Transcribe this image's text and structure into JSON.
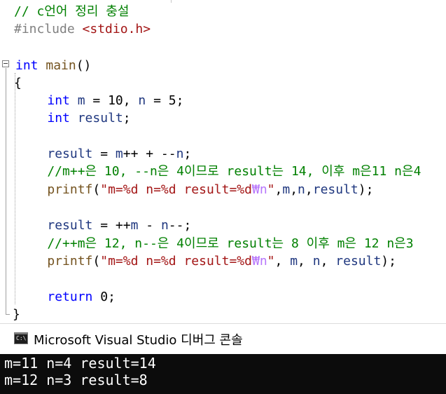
{
  "editor": {
    "lines": [
      [
        {
          "t": "// c언어 정리 충설",
          "c": "comment"
        }
      ],
      [
        {
          "t": "#include ",
          "c": "pp"
        },
        {
          "t": "<stdio.h>",
          "c": "string"
        }
      ],
      [],
      [
        {
          "t": "int",
          "c": "keyword"
        },
        {
          "t": " ",
          "c": "plain"
        },
        {
          "t": "main",
          "c": "func"
        },
        {
          "t": "()",
          "c": "plain"
        }
      ],
      [
        {
          "t": "{",
          "c": "plain"
        }
      ],
      [
        {
          "t": "    ",
          "c": "plain"
        },
        {
          "t": "int",
          "c": "keyword"
        },
        {
          "t": " ",
          "c": "plain"
        },
        {
          "t": "m",
          "c": "var"
        },
        {
          "t": " = 10, ",
          "c": "plain"
        },
        {
          "t": "n",
          "c": "var"
        },
        {
          "t": " = 5;",
          "c": "plain"
        }
      ],
      [
        {
          "t": "    ",
          "c": "plain"
        },
        {
          "t": "int",
          "c": "keyword"
        },
        {
          "t": " ",
          "c": "plain"
        },
        {
          "t": "result",
          "c": "var"
        },
        {
          "t": ";",
          "c": "plain"
        }
      ],
      [],
      [
        {
          "t": "    ",
          "c": "plain"
        },
        {
          "t": "result",
          "c": "var"
        },
        {
          "t": " = ",
          "c": "plain"
        },
        {
          "t": "m",
          "c": "var"
        },
        {
          "t": "++ + --",
          "c": "plain"
        },
        {
          "t": "n",
          "c": "var"
        },
        {
          "t": ";",
          "c": "plain"
        }
      ],
      [
        {
          "t": "    //m++은 10, --n은 4이므로 result는 14, 이후 m은11 n은4",
          "c": "comment"
        }
      ],
      [
        {
          "t": "    ",
          "c": "plain"
        },
        {
          "t": "printf",
          "c": "func"
        },
        {
          "t": "(",
          "c": "plain"
        },
        {
          "t": "\"m=%d n=%d result=%d",
          "c": "string"
        },
        {
          "t": "₩n",
          "c": "escape"
        },
        {
          "t": "\"",
          "c": "string"
        },
        {
          "t": ",",
          "c": "plain"
        },
        {
          "t": "m",
          "c": "var"
        },
        {
          "t": ",",
          "c": "plain"
        },
        {
          "t": "n",
          "c": "var"
        },
        {
          "t": ",",
          "c": "plain"
        },
        {
          "t": "result",
          "c": "var"
        },
        {
          "t": ");",
          "c": "plain"
        }
      ],
      [],
      [
        {
          "t": "    ",
          "c": "plain"
        },
        {
          "t": "result",
          "c": "var"
        },
        {
          "t": " = ++",
          "c": "plain"
        },
        {
          "t": "m",
          "c": "var"
        },
        {
          "t": " - ",
          "c": "plain"
        },
        {
          "t": "n",
          "c": "var"
        },
        {
          "t": "--;",
          "c": "plain"
        }
      ],
      [
        {
          "t": "    //++m은 12, n--은 4이므로 result는 8 이후 m은 12 n은3",
          "c": "comment"
        }
      ],
      [
        {
          "t": "    ",
          "c": "plain"
        },
        {
          "t": "printf",
          "c": "func"
        },
        {
          "t": "(",
          "c": "plain"
        },
        {
          "t": "\"m=%d n=%d result=%d",
          "c": "string"
        },
        {
          "t": "₩n",
          "c": "escape"
        },
        {
          "t": "\"",
          "c": "string"
        },
        {
          "t": ", ",
          "c": "plain"
        },
        {
          "t": "m",
          "c": "var"
        },
        {
          "t": ", ",
          "c": "plain"
        },
        {
          "t": "n",
          "c": "var"
        },
        {
          "t": ", ",
          "c": "plain"
        },
        {
          "t": "result",
          "c": "var"
        },
        {
          "t": ");",
          "c": "plain"
        }
      ],
      [],
      [
        {
          "t": "    ",
          "c": "plain"
        },
        {
          "t": "return",
          "c": "keyword"
        },
        {
          "t": " 0;",
          "c": "plain"
        }
      ],
      [
        {
          "t": "}",
          "c": "plain"
        }
      ]
    ]
  },
  "console": {
    "icon": "console-app-icon",
    "icon_text": "C:\\",
    "title": "Microsoft Visual Studio 디버그 콘솔",
    "output": [
      "m=11 n=4 result=14",
      "m=12 n=3 result=8"
    ]
  },
  "colors": {
    "comment": "#008000",
    "keyword": "#0000ff",
    "preprocessor": "#808080",
    "string": "#a31515",
    "escape": "#b776fb",
    "function": "#74531f",
    "variable": "#1f377f",
    "console_bg": "#0c0c0c"
  }
}
